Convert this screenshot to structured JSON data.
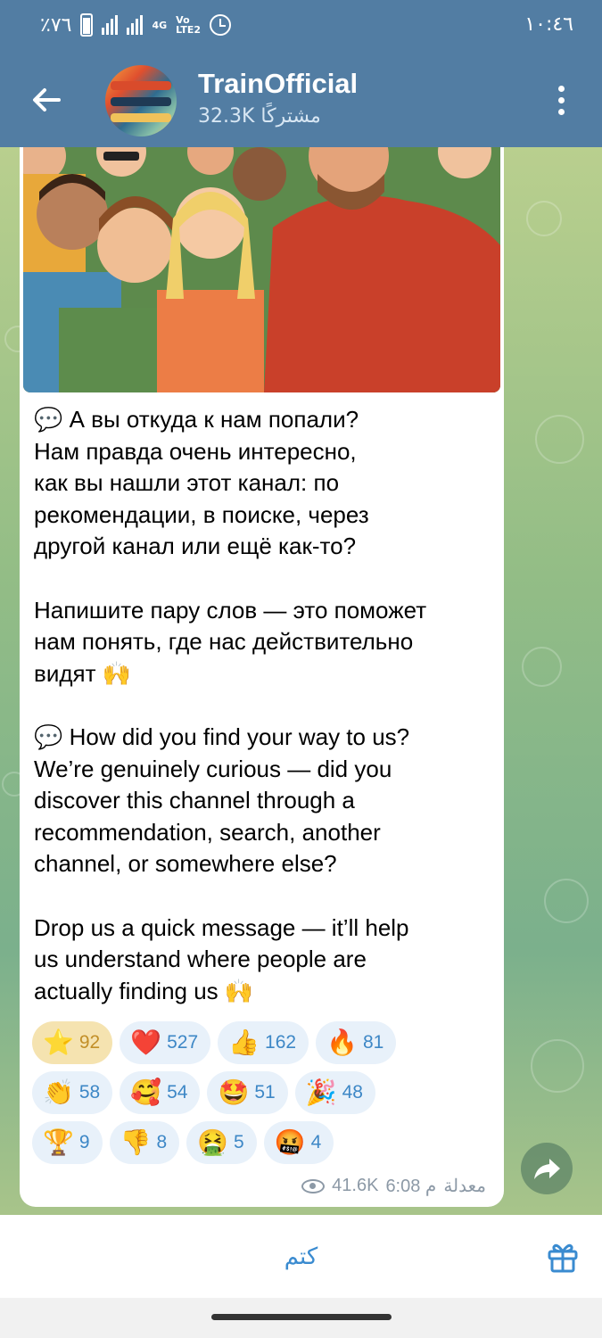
{
  "status_bar": {
    "battery_text": "٪٧٦",
    "network_tag_top": "4G",
    "network_tag_vo": "Vo",
    "network_tag_lte": "LTE2",
    "time": "١٠:٤٦"
  },
  "header": {
    "title": "TrainOfficial",
    "subtitle": "32.3K مشتركًا"
  },
  "message": {
    "text": "💬 А вы откуда к нам попали?\nНам правда очень интересно,\nкак вы нашли этот канал: по\nрекомендации, в поиске, через\nдругой канал или ещё как-то?\n\nНапишите пару слов — это поможет\nнам понять, где нас действительно\nвидят 🙌\n\n💬 How did you find your way to us?\nWe’re genuinely curious — did you\ndiscover this channel through a\nrecommendation, search, another\nchannel, or somewhere else?\n\nDrop us a quick message — it’ll help\nus understand where people are\nactually finding us 🙌",
    "reactions": [
      [
        {
          "emoji": "⭐",
          "count": "92",
          "active": true
        },
        {
          "emoji": "❤️",
          "count": "527",
          "active": false
        },
        {
          "emoji": "👍",
          "count": "162",
          "active": false
        },
        {
          "emoji": "🔥",
          "count": "81",
          "active": false
        }
      ],
      [
        {
          "emoji": "👏",
          "count": "58",
          "active": false
        },
        {
          "emoji": "🥰",
          "count": "54",
          "active": false
        },
        {
          "emoji": "🤩",
          "count": "51",
          "active": false
        },
        {
          "emoji": "🎉",
          "count": "48",
          "active": false
        }
      ],
      [
        {
          "emoji": "🏆",
          "count": "9",
          "active": false
        },
        {
          "emoji": "👎",
          "count": "8",
          "active": false
        },
        {
          "emoji": "🤮",
          "count": "5",
          "active": false
        },
        {
          "emoji": "🤬",
          "count": "4",
          "active": false
        }
      ]
    ],
    "views": "41.6K",
    "time": "6:08 م",
    "edited": "معدلة"
  },
  "bottom": {
    "mute_label": "كتم"
  },
  "colors": {
    "header": "#527da3",
    "accent": "#3a8bd0",
    "reaction_bg": "#e8f1fa",
    "reaction_active_bg": "#f5e3b0"
  },
  "icons": {
    "back": "arrow-left-icon",
    "menu": "more-vertical-icon",
    "share": "share-arrow-icon",
    "gift": "gift-icon",
    "views": "eye-icon"
  }
}
